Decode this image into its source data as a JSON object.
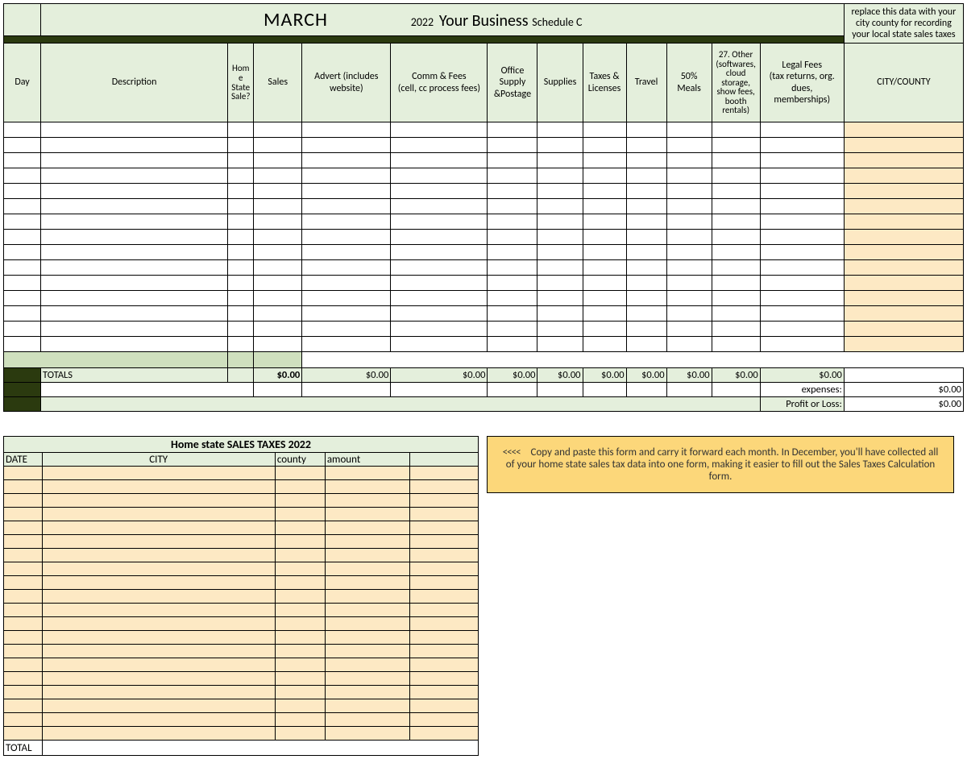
{
  "title": {
    "month": "MARCH",
    "year": "2022",
    "business": "Your Business",
    "schedule": "Schedule C"
  },
  "cc": {
    "note": "replace this data with your city county for recording your local state sales taxes",
    "header": "CITY/COUNTY"
  },
  "headers": {
    "day": "Day",
    "desc": "Description",
    "home": "Home State Sale?",
    "sales": "Sales",
    "advert": "Advert (includes website)",
    "comm": "Comm & Fees (cell, cc process fees)",
    "office": "Office Supply &Postage",
    "supplies": "Supplies",
    "taxes": "Taxes & Licenses",
    "travel": "Travel",
    "meals": "50% Meals",
    "other": "27. Other (softwares, cloud storage, show fees, booth rentals)",
    "legal": "Legal Fees (tax returns, org. dues, memberships)"
  },
  "totals": {
    "label": "TOTALS",
    "sales": "$0.00",
    "advert": "$0.00",
    "comm": "$0.00",
    "office": "$0.00",
    "supplies": "$0.00",
    "taxes": "$0.00",
    "travel": "$0.00",
    "meals": "$0.00",
    "other": "$0.00",
    "legal": "$0.00",
    "expenses_label": "expenses:",
    "expenses_amt": "$0.00",
    "pl_label": "Profit or Loss:",
    "pl_amt": "$0.00"
  },
  "taxform": {
    "title": "Home state SALES TAXES 2022",
    "hdr_date": "DATE",
    "hdr_city": "CITY",
    "hdr_county": "county",
    "hdr_amt": "amount",
    "total_label": "TOTAL"
  },
  "notebox": {
    "arrows": "<<<<",
    "text": "Copy and paste this form and carry it forward each month. In December, you'll have collected all of your home state sales tax data into one form, making it easier to fill out the Sales Taxes Calculation form."
  },
  "rows": [
    null,
    null,
    null,
    null,
    null,
    null,
    null,
    null,
    null,
    null,
    null,
    null,
    null,
    null,
    null
  ],
  "tax_rows": [
    null,
    null,
    null,
    null,
    null,
    null,
    null,
    null,
    null,
    null,
    null,
    null,
    null,
    null,
    null,
    null,
    null,
    null,
    null,
    null
  ]
}
